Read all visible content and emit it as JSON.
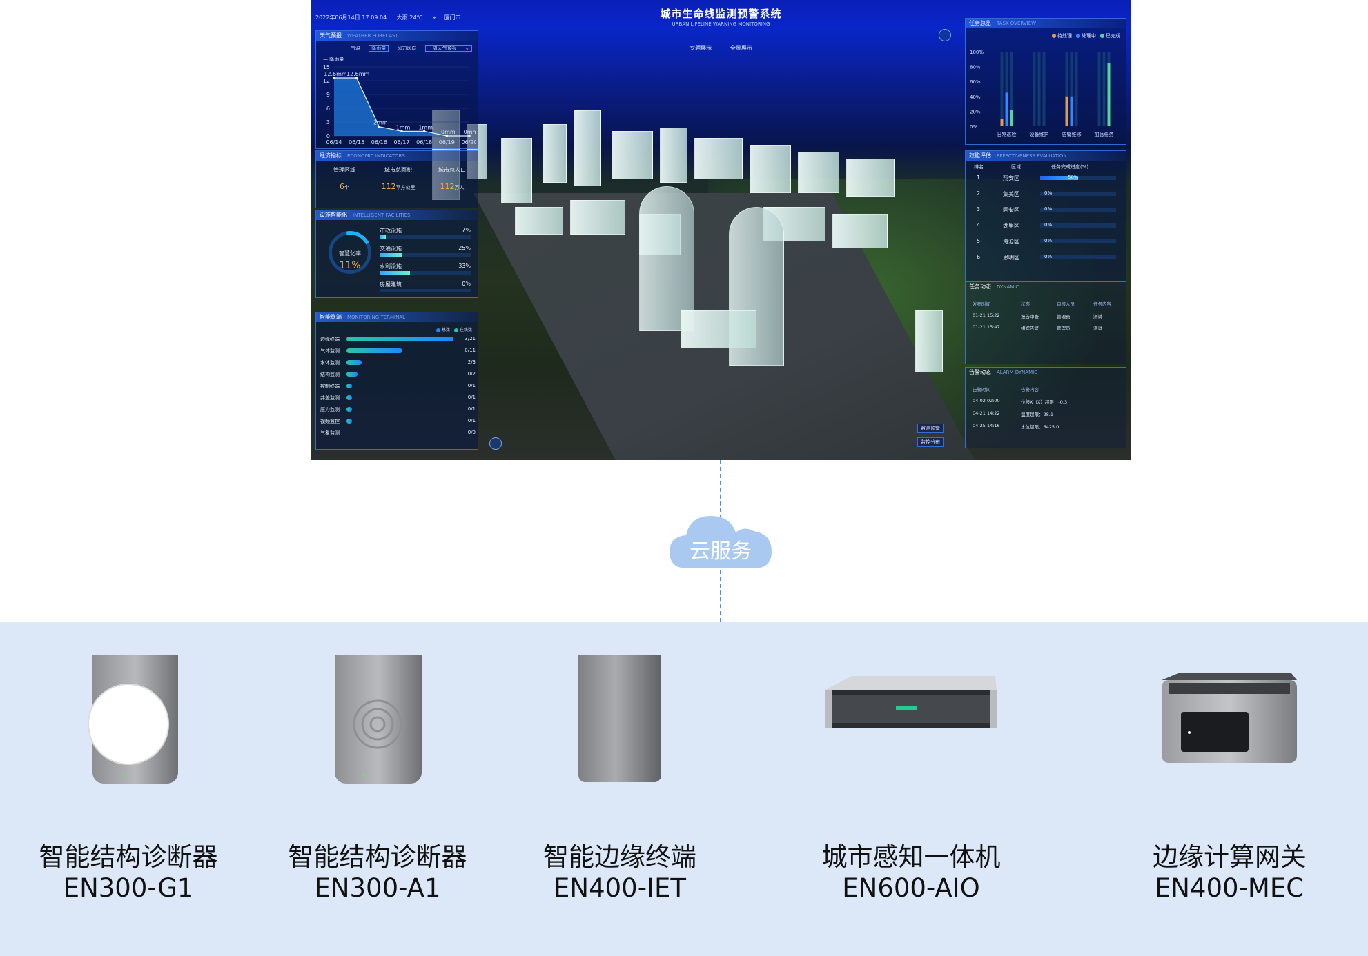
{
  "dashboard": {
    "datetime": "2022年06月14日 17:09:04",
    "weather_now": "大雨 24℃",
    "city": "厦门市",
    "title": "城市生命线监测预警系统",
    "subtitle": "URBAN LIFELINE WARNING MONITORING",
    "view_tabs": [
      "专题展示",
      "全景展示"
    ],
    "weather_panel": {
      "title": "天气预报",
      "title_en": "WEATHER FORECAST",
      "tabs": [
        "气温",
        "降雨量",
        "风力风向"
      ],
      "active_tab": "降雨量",
      "select": "一周天气预报",
      "legend": "降雨量",
      "chart_data": {
        "type": "area",
        "categories": [
          "06/14",
          "06/15",
          "06/16",
          "06/17",
          "06/18",
          "06/19",
          "06/20"
        ],
        "series": [
          {
            "name": "降雨量",
            "values": [
              12.6,
              12.6,
              2,
              1,
              1,
              0,
              0
            ]
          }
        ],
        "data_labels": [
          "12.6mm",
          "12.6mm",
          "2mm",
          "1mm",
          "1mm",
          "0mm",
          "0mm"
        ],
        "y_ticks": [
          "15",
          "12",
          "9",
          "6",
          "3",
          "0"
        ],
        "ylim": [
          0,
          15
        ]
      }
    },
    "economy_panel": {
      "title": "经济指标",
      "title_en": "ECONOMIC INDICATORS",
      "items": [
        {
          "label": "管理区域",
          "value": "6",
          "unit": "个"
        },
        {
          "label": "城市总面积",
          "value": "112",
          "unit": "平方公里"
        },
        {
          "label": "城市总人口",
          "value": "112",
          "unit": "万人"
        }
      ]
    },
    "facility_panel": {
      "title": "设施智能化",
      "title_en": "INTELLIGENT FACILITIES",
      "gauge_label": "智慧化率",
      "gauge_value": "11%",
      "items": [
        {
          "label": "市政设施",
          "percent": "7%",
          "level": 0.07
        },
        {
          "label": "交通设施",
          "percent": "25%",
          "level": 0.25
        },
        {
          "label": "水利设施",
          "percent": "33%",
          "level": 0.33
        },
        {
          "label": "房屋建筑",
          "percent": "0%",
          "level": 0
        }
      ]
    },
    "terminal_panel": {
      "title": "智能终端",
      "title_en": "MONITORING TERMINAL",
      "legend": [
        "总数",
        "在线数"
      ],
      "items": [
        {
          "label": "边缘终端",
          "value": "3/21",
          "level": 1.0
        },
        {
          "label": "气体监测",
          "value": "0/11",
          "level": 0.52
        },
        {
          "label": "水体监测",
          "value": "2/3",
          "level": 0.14
        },
        {
          "label": "结构监测",
          "value": "0/2",
          "level": 0.1
        },
        {
          "label": "控制终端",
          "value": "0/1",
          "level": 0.05
        },
        {
          "label": "井盖监测",
          "value": "0/1",
          "level": 0.05
        },
        {
          "label": "压力监测",
          "value": "0/1",
          "level": 0.05
        },
        {
          "label": "视频监控",
          "value": "0/1",
          "level": 0.05
        },
        {
          "label": "气象监测",
          "value": "0/0",
          "level": 0
        }
      ]
    },
    "task_panel": {
      "title": "任务总览",
      "title_en": "TASK OVERVIEW",
      "legend": [
        "待处理",
        "处理中",
        "已完成"
      ],
      "chart_data": {
        "type": "bar",
        "categories": [
          "日常巡检",
          "设备维护",
          "告警维修",
          "加急任务"
        ],
        "series": [
          {
            "name": "待处理",
            "values": [
              10,
              0,
              40,
              0
            ]
          },
          {
            "name": "处理中",
            "values": [
              45,
              0,
              40,
              0
            ]
          },
          {
            "name": "已完成",
            "values": [
              22,
              0,
              0,
              85
            ]
          }
        ],
        "y_ticks": [
          "100%",
          "80%",
          "60%",
          "40%",
          "20%",
          "0%"
        ],
        "ylim": [
          0,
          100
        ]
      }
    },
    "effect_panel": {
      "title": "效能评估",
      "title_en": "EFFECTIVENESS EVALUATION",
      "headers": [
        "排名",
        "区域",
        "任务完成进度(%)"
      ],
      "rows": [
        {
          "rank": "1",
          "district": "翔安区",
          "progress": "50%",
          "level": 0.5
        },
        {
          "rank": "2",
          "district": "集美区",
          "progress": "0%",
          "level": 0
        },
        {
          "rank": "3",
          "district": "同安区",
          "progress": "0%",
          "level": 0
        },
        {
          "rank": "4",
          "district": "湖里区",
          "progress": "0%",
          "level": 0
        },
        {
          "rank": "5",
          "district": "海沧区",
          "progress": "0%",
          "level": 0
        },
        {
          "rank": "6",
          "district": "思明区",
          "progress": "0%",
          "level": 0
        }
      ]
    },
    "task_dynamic": {
      "title": "任务动态",
      "title_en": "DYNAMIC",
      "headers": [
        "发布时间",
        "状态",
        "审核人员",
        "任务内容"
      ],
      "rows": [
        {
          "time": "01-21 15:22",
          "status": "报告审查",
          "person": "管理员",
          "content": "测试"
        },
        {
          "time": "01-21 15:47",
          "status": "组织告警",
          "person": "管理员",
          "content": "测试"
        }
      ]
    },
    "alarm_dynamic": {
      "title": "告警动态",
      "title_en": "ALARM DYNAMIC",
      "headers": [
        "告警时间",
        "告警内容"
      ],
      "rows": [
        {
          "time": "04-02 02:00",
          "content": "位移X（X）超限：-0.3"
        },
        {
          "time": "04-21 14:22",
          "content": "温度超限：28.1"
        },
        {
          "time": "04-25 14:16",
          "content": "水位超限：6425.0"
        }
      ]
    },
    "map_buttons": [
      "监测预警",
      "监控分布"
    ]
  },
  "cloud_label": "云服务",
  "devices": [
    {
      "name": "智能结构诊断器",
      "model": "EN300-G1"
    },
    {
      "name": "智能结构诊断器",
      "model": "EN300-A1"
    },
    {
      "name": "智能边缘终端",
      "model": "EN400-IET"
    },
    {
      "name": "城市感知一体机",
      "model": "EN600-AIO"
    },
    {
      "name": "边缘计算网关",
      "model": "EN400-MEC"
    }
  ]
}
